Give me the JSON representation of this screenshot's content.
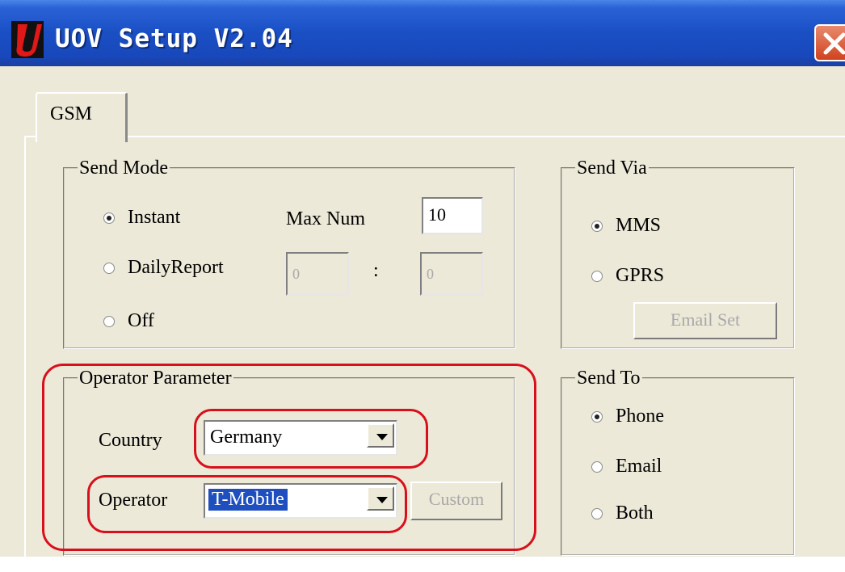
{
  "window": {
    "title": "UOV Setup V2.04"
  },
  "tabs": [
    {
      "label": "GSM",
      "selected": true
    }
  ],
  "send_mode": {
    "legend": "Send Mode",
    "options": [
      {
        "label": "Instant",
        "checked": true
      },
      {
        "label": "DailyReport",
        "checked": false
      },
      {
        "label": "Off",
        "checked": false
      }
    ],
    "max_num_label": "Max Num",
    "max_num_value": "10",
    "daily_hour": "0",
    "separator": ":",
    "daily_minute": "0"
  },
  "send_via": {
    "legend": "Send Via",
    "options": [
      {
        "label": "MMS",
        "checked": true
      },
      {
        "label": "GPRS",
        "checked": false
      }
    ],
    "email_set_label": "Email Set"
  },
  "operator_parameter": {
    "legend": "Operator Parameter",
    "country_label": "Country",
    "country_value": "Germany",
    "operator_label": "Operator",
    "operator_value": "T-Mobile",
    "custom_label": "Custom"
  },
  "send_to": {
    "legend": "Send To",
    "options": [
      {
        "label": "Phone",
        "checked": true
      },
      {
        "label": "Email",
        "checked": false
      },
      {
        "label": "Both",
        "checked": false
      }
    ]
  },
  "colors": {
    "titlebar": "#1a4fc4",
    "dialog_bg": "#ECE9D8",
    "highlight": "#d8101c",
    "selection": "#1f4fbf"
  }
}
